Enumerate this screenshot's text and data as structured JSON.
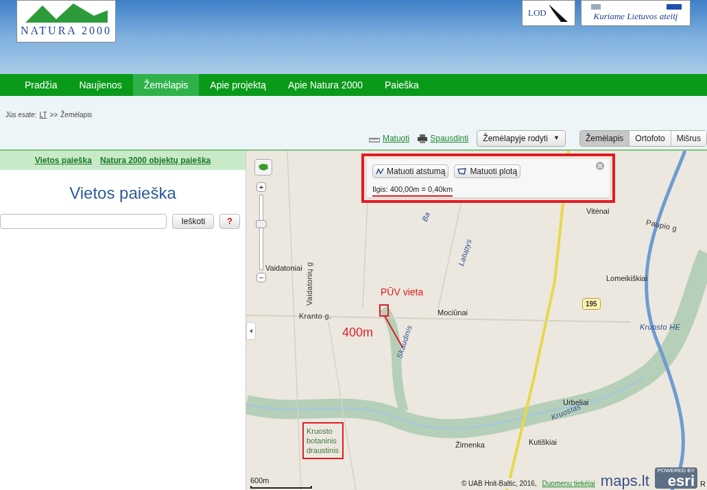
{
  "header": {
    "logo_text": "NATURA 2000",
    "partner_logos": [
      {
        "kind": "bird",
        "text": "LOD"
      },
      {
        "kind": "flags",
        "text": "Kuriame Lietuvos ateitį"
      }
    ]
  },
  "nav": [
    {
      "label": "Pradžia",
      "selected": false
    },
    {
      "label": "Naujienos",
      "selected": false
    },
    {
      "label": "Žemėlapis",
      "selected": true
    },
    {
      "label": "Apie projektą",
      "selected": false
    },
    {
      "label": "Apie Natura 2000",
      "selected": false
    },
    {
      "label": "Paieška",
      "selected": false
    }
  ],
  "breadcrumb": {
    "prefix": "Jūs esate:",
    "link": "LT",
    "separator": ">>",
    "current": "Žemėlapis"
  },
  "toolbar": {
    "measure_link": "Matuoti",
    "print_link": "Spausdinti",
    "dropdown": "Žemėlapyje rodyti",
    "dropdown_caret": "▼",
    "map_types": [
      {
        "label": "Žemėlapis",
        "selected": true
      },
      {
        "label": "Ortofoto",
        "selected": false
      },
      {
        "label": "Mišrus",
        "selected": false
      }
    ]
  },
  "left_panel": {
    "links": [
      "Vietos paieška",
      "Natura 2000 objektų paieška"
    ],
    "title": "Vietos paieška",
    "search_button": "Ieškoti",
    "help_button": "?"
  },
  "map": {
    "zoom": {
      "plus": "+",
      "minus": "−",
      "level": 0.63
    },
    "measure_panel": {
      "buttons": [
        {
          "label": "Matuoti atstumą",
          "kind": "distance"
        },
        {
          "label": "Matuoti plotą",
          "kind": "area"
        }
      ],
      "result": "Ilgis: 400,00m = 0,40km"
    },
    "labels": [
      {
        "text": "Ba",
        "kind": "water"
      },
      {
        "text": "Vitėnai",
        "kind": "place"
      },
      {
        "text": "Paupio g",
        "kind": "street"
      },
      {
        "text": "Vaidatoniai",
        "kind": "place"
      },
      {
        "text": "Vaidatonių g",
        "kind": "street"
      },
      {
        "text": "Latupys",
        "kind": "water"
      },
      {
        "text": "Lomeikiškiai",
        "kind": "place"
      },
      {
        "text": "195",
        "kind": "road_number"
      },
      {
        "text": "Kranto g.",
        "kind": "street"
      },
      {
        "text": "Mociūnai",
        "kind": "place"
      },
      {
        "text": "Kruosto HE",
        "kind": "water"
      },
      {
        "text": "Skaudinis",
        "kind": "water"
      },
      {
        "text": "Urbeliai",
        "kind": "place"
      },
      {
        "text": "Kruostas",
        "kind": "water"
      },
      {
        "text": "Kruosto botaninis draustinis",
        "kind": "protected_area"
      },
      {
        "text": "Žirnenka",
        "kind": "place"
      },
      {
        "text": "Kutiškiai",
        "kind": "place"
      },
      {
        "text": "R",
        "kind": "place"
      }
    ],
    "annotations": {
      "site_label": "PŪV vieta",
      "distance_label": "400m"
    },
    "scale": "600m",
    "attribution": {
      "text": "© UAB Hnit-Baltic, 2016,",
      "link": "Duomenu tiekėjai"
    },
    "brand": {
      "maps": "maps.lt",
      "powered": "POWERED BY",
      "esri": "esri"
    }
  }
}
